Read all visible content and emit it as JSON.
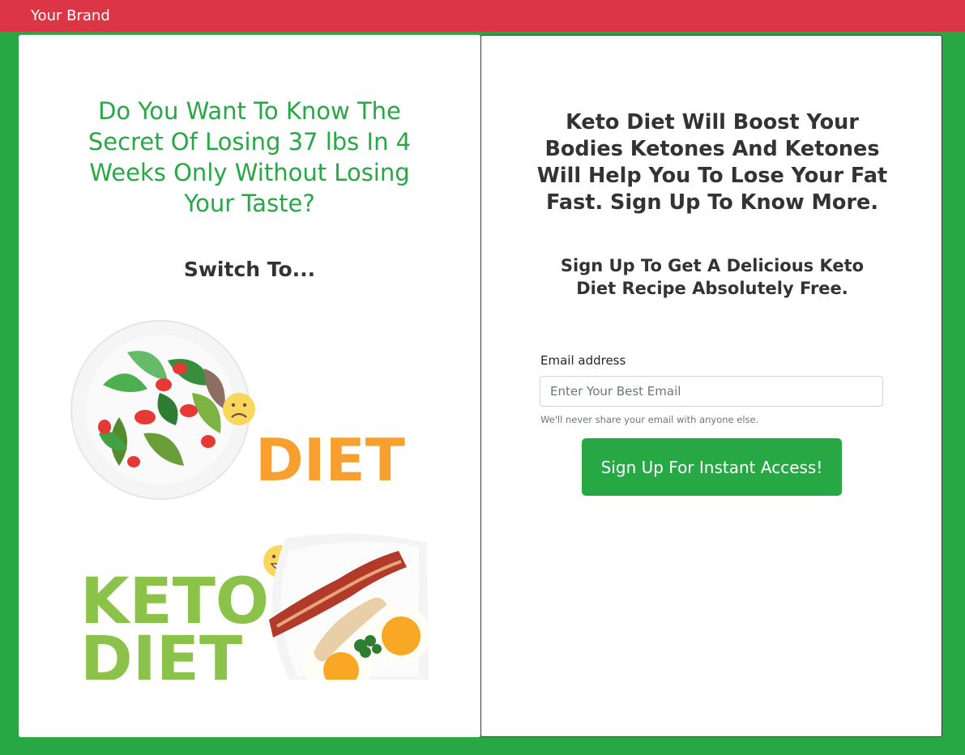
{
  "navbar": {
    "brand": "Your Brand"
  },
  "left": {
    "headline": "Do You Want To Know The Secret Of Losing 37 lbs In 4 Weeks Only Without Losing Your Taste?",
    "switch": "Switch To...",
    "image": {
      "top_word": "DIET",
      "bottom_word_1": "KETO",
      "bottom_word_2": "DIET"
    }
  },
  "right": {
    "headline": "Keto Diet Will Boost Your Bodies Ketones And Ketones Will Help You To Lose Your Fat Fast. Sign Up To Know More.",
    "subheadline": "Sign Up To Get A Delicious Keto Diet Recipe Absolutely Free.",
    "form": {
      "email_label": "Email address",
      "email_placeholder": "Enter Your Best Email",
      "email_value": "",
      "help_text": "We'll never share your email with anyone else.",
      "submit_label": "Sign Up For Instant Access!"
    }
  },
  "colors": {
    "brand_bar": "#dc3545",
    "accent": "#28a745",
    "diet_orange": "#f7a030",
    "keto_green": "#8bc34a"
  }
}
